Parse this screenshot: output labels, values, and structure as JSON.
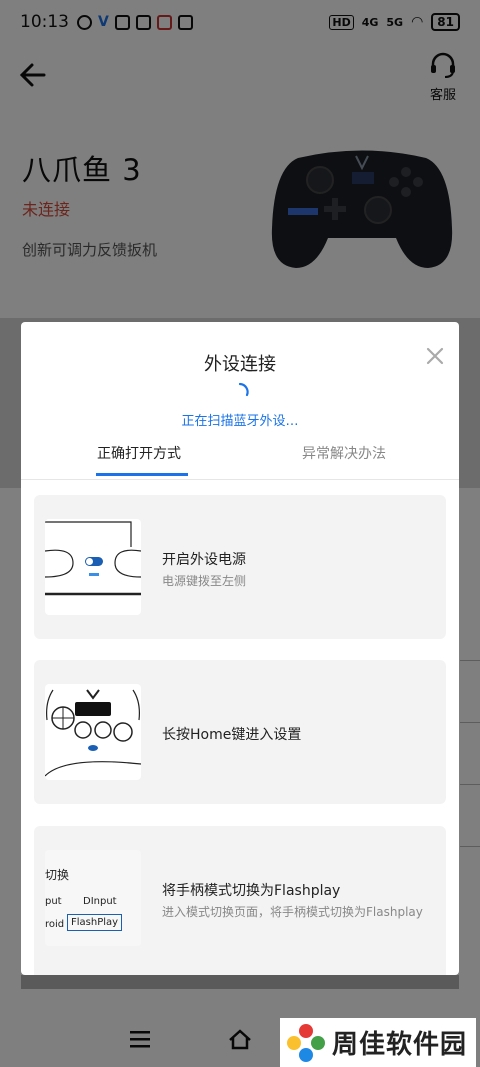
{
  "status_bar": {
    "time": "10:13",
    "hd_label": "HD",
    "signal1": "4G",
    "signal2": "5G",
    "battery": "81"
  },
  "header": {
    "support_label": "客服"
  },
  "device": {
    "name": "八爪鱼 3",
    "status": "未连接",
    "description": "创新可调力反馈扳机"
  },
  "dialog": {
    "title": "外设连接",
    "scanning_text": "正在扫描蓝牙外设…",
    "tabs": [
      {
        "label": "正确打开方式",
        "active": true
      },
      {
        "label": "异常解决办法",
        "active": false
      }
    ],
    "steps": [
      {
        "title": "开启外设电源",
        "subtitle": "电源键拨至左侧"
      },
      {
        "title": "长按Home键进入设置",
        "subtitle": ""
      },
      {
        "title": "将手柄模式切换为Flashplay",
        "subtitle": "进入模式切换页面，将手柄模式切换为Flashplay"
      }
    ],
    "step3_image_texts": [
      "切换",
      "put",
      "DInput",
      "roid",
      "FlashPlay"
    ]
  },
  "watermark": {
    "text": "周佳软件园"
  },
  "colors": {
    "accent": "#1a73e8",
    "status_red": "#d64a3a"
  }
}
